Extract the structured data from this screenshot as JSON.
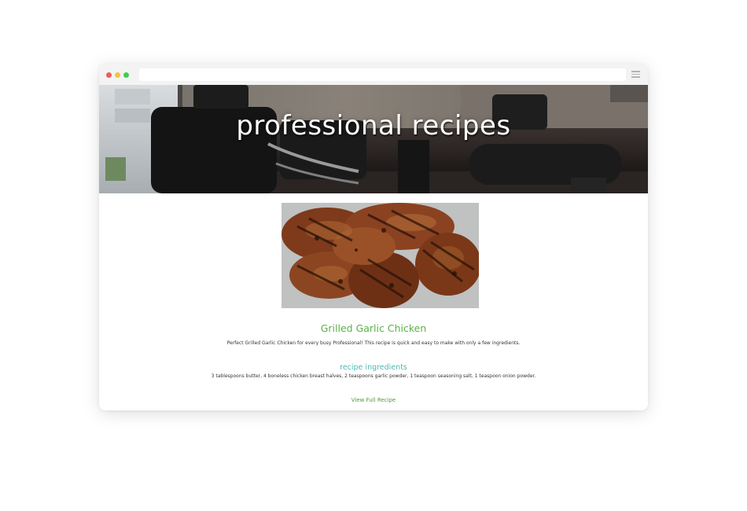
{
  "window": {
    "traffic_lights": {
      "close": "#f25c54",
      "minimize": "#f7c33b",
      "maximize": "#3ecf4c"
    },
    "address_bar_text": "",
    "menu_icon": "hamburger-menu-icon"
  },
  "hero": {
    "title": "professional recipes",
    "image": "office-conference-room-chairs"
  },
  "recipe": {
    "image": "grilled-chicken-breasts",
    "title": "Grilled Garlic Chicken",
    "description": "Perfect Grilled Garlic Chicken for every busy Professional! This recipe is quick and easy to make with only a few ingredients.",
    "ingredients_heading": "recipe ingredients",
    "ingredients": "3 tablespoons butter, 4 boneless chicken breast halves, 2 teaspoons garlic powder, 1 teaspoon seasoning salt, 1 teaspoon onion powder.",
    "link_label": "View Full Recipe"
  },
  "colors": {
    "title_green": "#5cb04a",
    "heading_teal": "#4fb8b5",
    "link_green": "#4f9a3a"
  }
}
